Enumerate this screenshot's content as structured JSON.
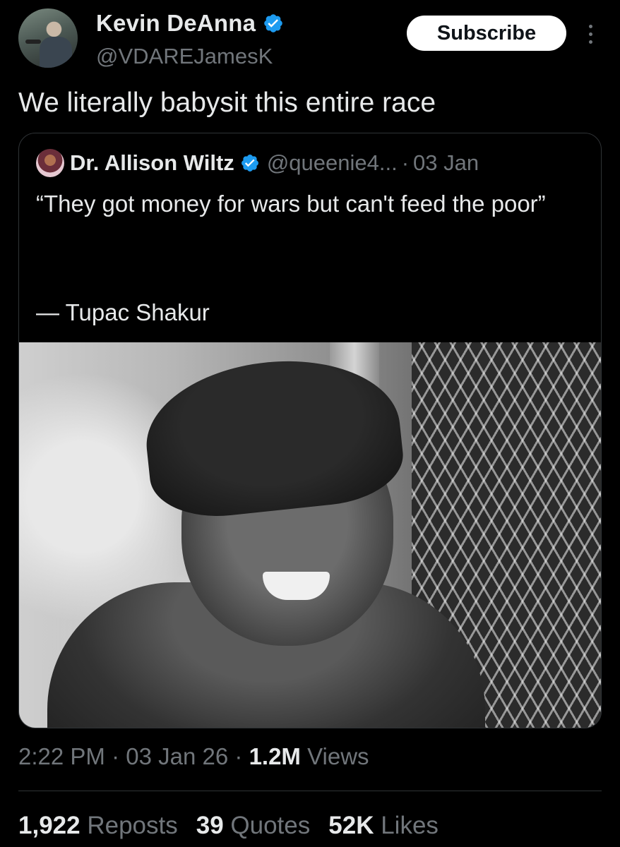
{
  "author": {
    "display_name": "Kevin DeAnna",
    "handle": "@VDAREJamesK",
    "verified": true
  },
  "header": {
    "subscribe_label": "Subscribe",
    "more_icon": "more-vertical-icon"
  },
  "tweet": {
    "text": "We literally babysit this entire race"
  },
  "quoted_tweet": {
    "display_name": "Dr. Allison Wiltz",
    "handle": "@queenie4...",
    "separator": "·",
    "date": "03 Jan",
    "verified": true,
    "text": "“They got money for wars but can't feed the poor”",
    "attribution": "— Tupac Shakur"
  },
  "meta": {
    "time": "2:22 PM",
    "separator": "·",
    "date": "03 Jan 26",
    "views_count": "1.2M",
    "views_label": "Views"
  },
  "stats": {
    "reposts_count": "1,922",
    "reposts_label": "Reposts",
    "quotes_count": "39",
    "quotes_label": "Quotes",
    "likes_count": "52K",
    "likes_label": "Likes"
  },
  "colors": {
    "background": "#000000",
    "text_primary": "#e7e9ea",
    "text_secondary": "#71767b",
    "verified_blue": "#1d9bf0",
    "border": "#2f3336"
  }
}
